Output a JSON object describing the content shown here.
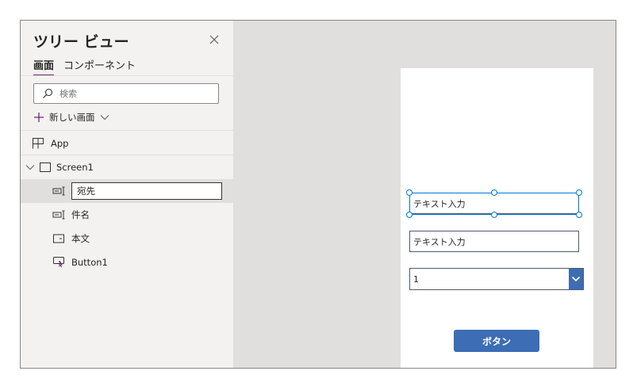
{
  "panel": {
    "title": "ツリー ビュー",
    "tabs": [
      {
        "label": "画面",
        "active": true
      },
      {
        "label": "コンポーネント",
        "active": false
      }
    ],
    "search_placeholder": "検索",
    "new_screen_label": "新しい画面",
    "app_label": "App",
    "screen_label": "Screen1",
    "items": [
      {
        "label": "宛先",
        "icon": "text-input-icon",
        "editing": true
      },
      {
        "label": "件名",
        "icon": "text-input-icon",
        "editing": false
      },
      {
        "label": "本文",
        "icon": "textarea-icon",
        "editing": false
      },
      {
        "label": "Button1",
        "icon": "button-control-icon",
        "editing": false
      }
    ]
  },
  "canvas": {
    "textinput1_text": "テキスト入力",
    "textinput2_text": "テキスト入力",
    "dropdown_value": "1",
    "button_label": "ボタン"
  },
  "colors": {
    "accent": "#742774",
    "selection": "#0078d4",
    "control_blue": "#3c6db5",
    "panel_bg": "#f3f2f1",
    "canvas_bg": "#e1dfdd"
  }
}
